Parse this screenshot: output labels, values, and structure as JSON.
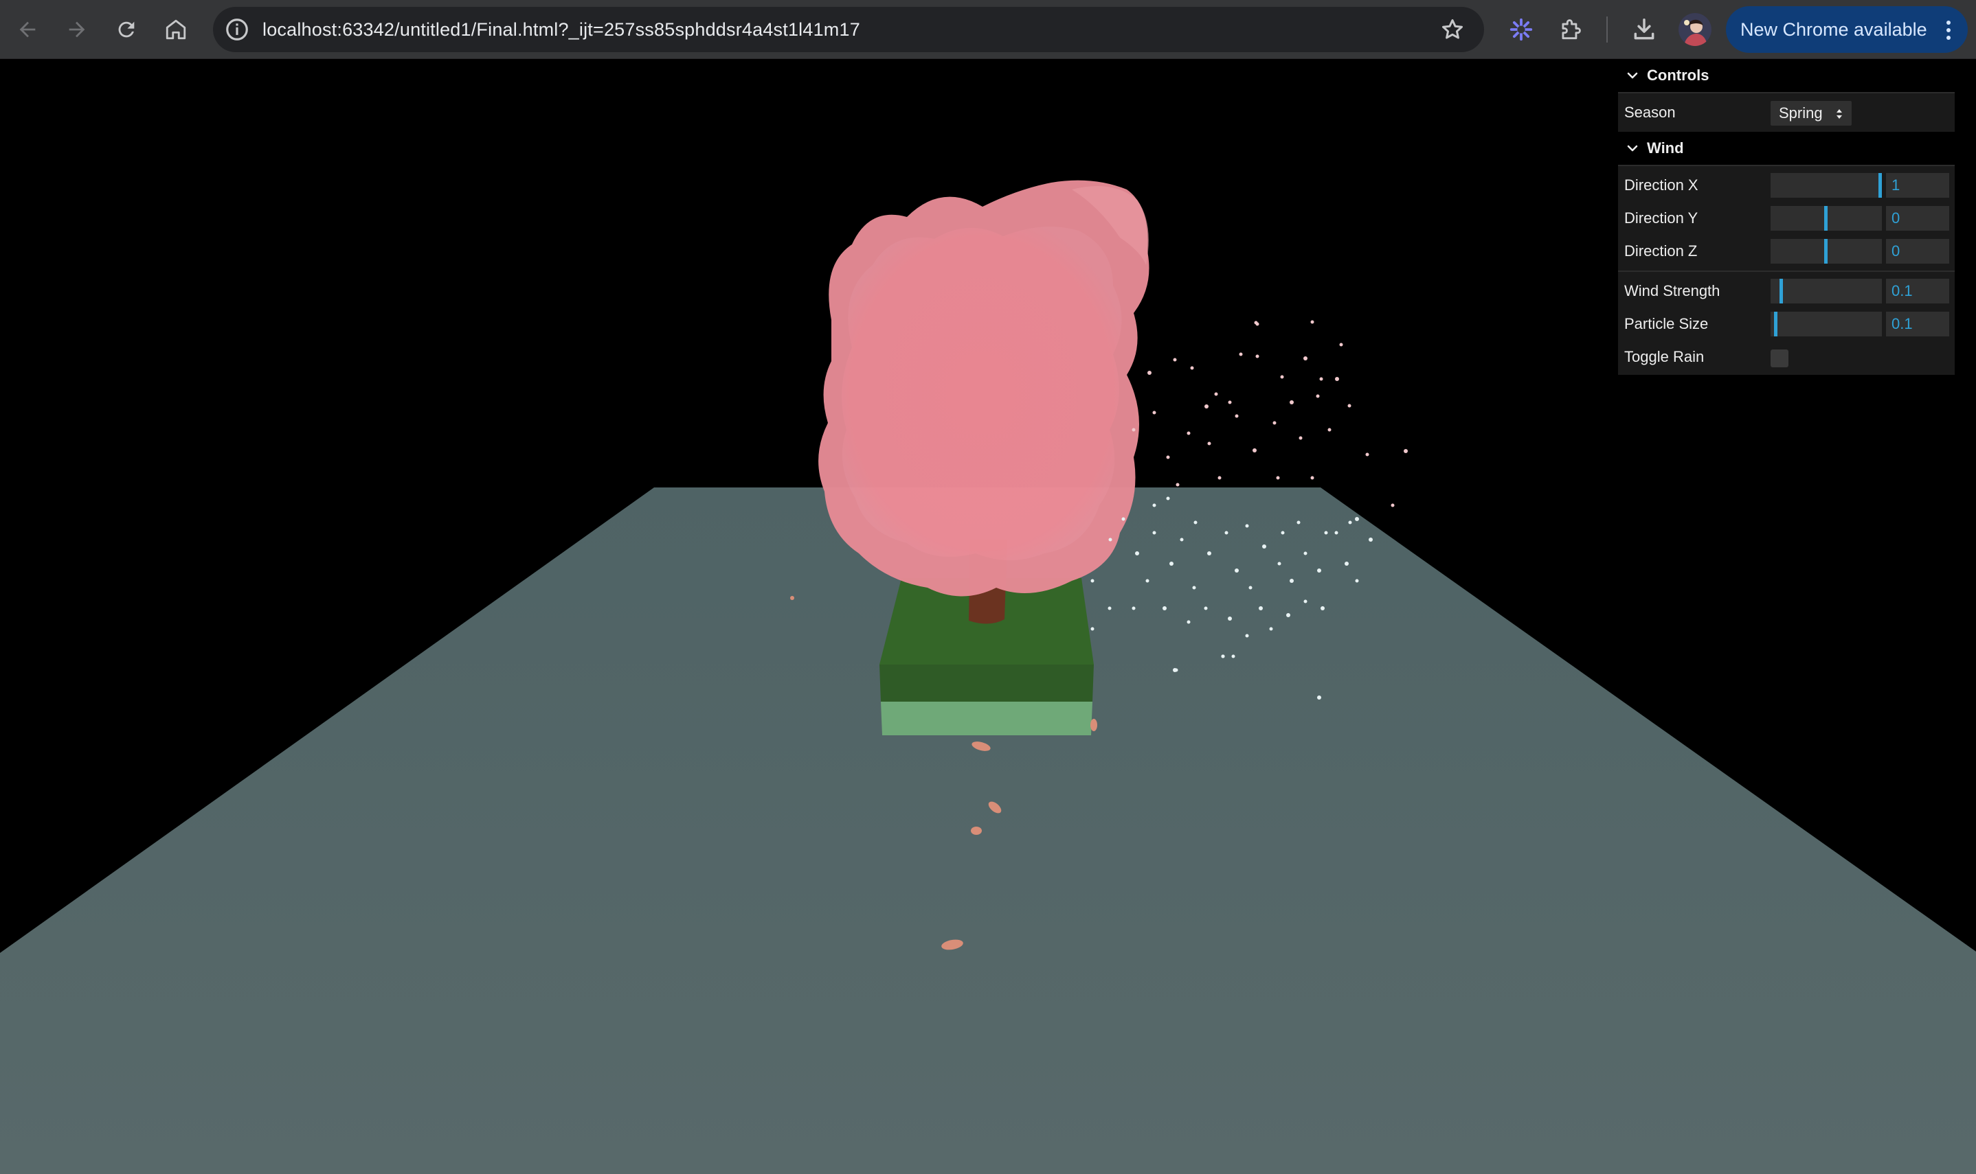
{
  "browser": {
    "url": "localhost:63342/untitled1/Final.html?_ijt=257ss85sphddsr4a4st1l41m17",
    "update_label": "New Chrome available",
    "icons": [
      "back-icon",
      "forward-icon",
      "reload-icon",
      "home-icon",
      "site-info-icon",
      "bookmark-star-icon",
      "extension-icon",
      "puzzle-icon",
      "download-icon",
      "avatar",
      "more-vert-icon"
    ]
  },
  "gui": {
    "controls_title": "Controls",
    "season_label": "Season",
    "season_value": "Spring",
    "wind_title": "Wind",
    "direction_x": {
      "label": "Direction X",
      "value": "1",
      "fraction": 1.0
    },
    "direction_y": {
      "label": "Direction Y",
      "value": "0",
      "fraction": 0.5
    },
    "direction_z": {
      "label": "Direction Z",
      "value": "0",
      "fraction": 0.5
    },
    "wind_strength": {
      "label": "Wind Strength",
      "value": "0.1",
      "fraction": 0.1
    },
    "particle_size": {
      "label": "Particle Size",
      "value": "0.1",
      "fraction": 0.05
    },
    "toggle_rain": {
      "label": "Toggle Rain",
      "checked": false
    }
  },
  "scene": {
    "sky_color": "#000000",
    "ground_color": "#56686a",
    "foliage_color": "#ee8a95",
    "trunk_color": "#6b3320",
    "grass_dark": "#336229",
    "grass_light": "#6ea877",
    "petal_color": "#d98e78"
  },
  "colors": {
    "chrome_bg": "#353638",
    "omnibox_bg": "#222326",
    "accent_blue": "#2fa1d6",
    "update_pill": "#0f3d78"
  }
}
